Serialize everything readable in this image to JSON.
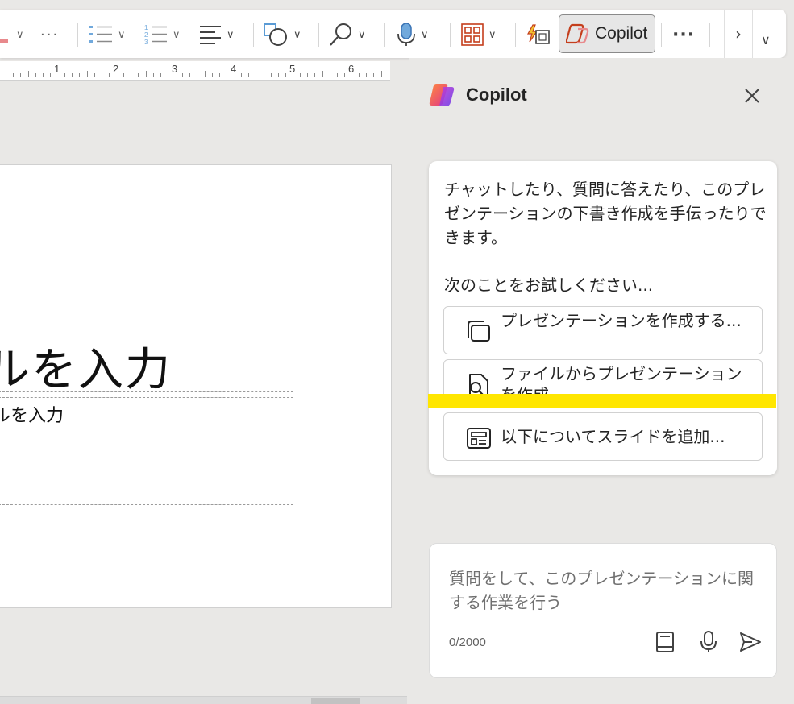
{
  "toolbar": {
    "copilot_label": "Copilot",
    "more_label": "···",
    "icons": [
      "font-color-icon",
      "bullets-icon",
      "numbering-icon",
      "align-icon",
      "shapes-icon",
      "find-icon",
      "dictate-icon",
      "designer-icon",
      "convert-icon",
      "copilot-icon",
      "more-icon",
      "chevron-right-icon",
      "collapse-ribbon-icon"
    ]
  },
  "ruler": {
    "numbers": [
      "1",
      "2",
      "3",
      "4",
      "5",
      "6"
    ]
  },
  "slide": {
    "title_text": "ルを入力",
    "subtitle_text": "ルを入力"
  },
  "copilot": {
    "title": "Copilot",
    "intro": "チャットしたり、質問に答えたり、このプレゼンテーションの下書き作成を手伝ったりできます。",
    "try_label": "次のことをお試しください...",
    "suggestions": [
      {
        "label": "プレゼンテーションを作成する...",
        "icon": "slides-stack-icon"
      },
      {
        "label": "ファイルからプレゼンテーションを作成...",
        "icon": "file-search-icon"
      },
      {
        "label": "以下についてスライドを追加...",
        "icon": "slide-layout-icon"
      }
    ],
    "input_placeholder": "質問をして、このプレゼンテーションに関する作業を行う",
    "counter": "0/2000"
  },
  "colors": {
    "highlight": "#ffe600",
    "accent_red": "#c43e1c"
  }
}
